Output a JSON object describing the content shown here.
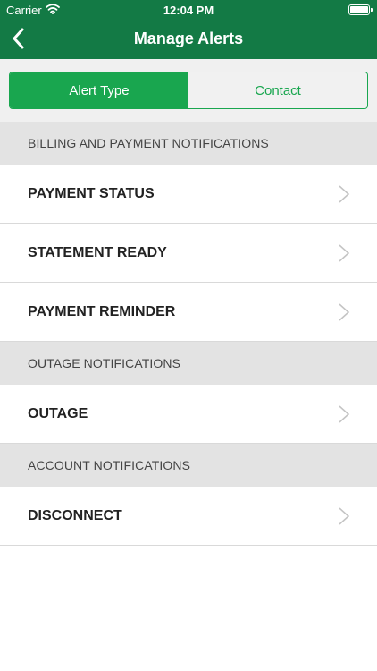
{
  "status_bar": {
    "carrier": "Carrier",
    "time": "12:04 PM"
  },
  "nav": {
    "title": "Manage Alerts"
  },
  "segments": [
    {
      "label": "Alert Type",
      "selected": true
    },
    {
      "label": "Contact",
      "selected": false
    }
  ],
  "sections": [
    {
      "title": "BILLING AND PAYMENT NOTIFICATIONS",
      "items": [
        "PAYMENT STATUS",
        "STATEMENT READY",
        "PAYMENT REMINDER"
      ]
    },
    {
      "title": "OUTAGE NOTIFICATIONS",
      "items": [
        "OUTAGE"
      ]
    },
    {
      "title": "ACCOUNT NOTIFICATIONS",
      "items": [
        "DISCONNECT"
      ]
    }
  ],
  "colors": {
    "nav_green": "#137a45",
    "accent_green": "#19a64f",
    "section_gray": "#e3e3e3"
  }
}
